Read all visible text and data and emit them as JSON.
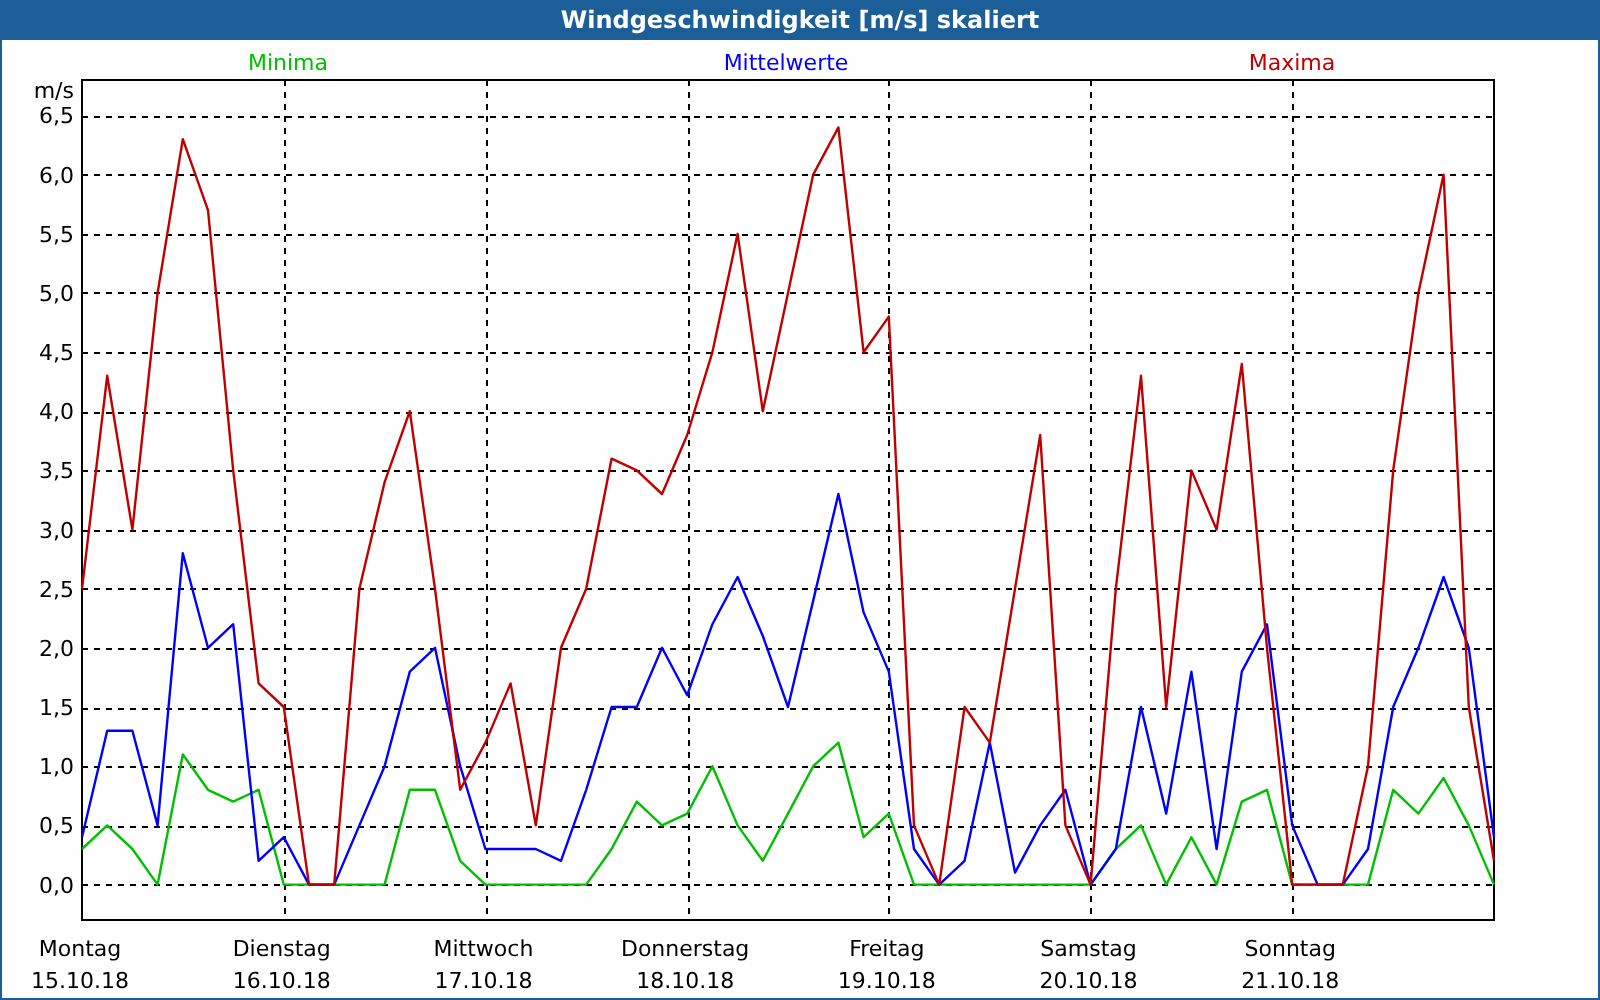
{
  "window": {
    "title": "Windgeschwindigkeit [m/s] skaliert"
  },
  "chart": {
    "dates": [
      "15.10.18",
      "16.10.18",
      "17.10.18",
      "18.10.18",
      "19.10.18",
      "20.10.18",
      "21.10.18"
    ],
    "chart_data": {
      "type": "line",
      "ylabel": "m/s",
      "ylim": [
        -0.3,
        6.8
      ],
      "grid": true,
      "yticks": [
        {
          "value": 0,
          "label": "0,0"
        },
        {
          "value": 0.5,
          "label": "0,5"
        },
        {
          "value": 1,
          "label": "1,0"
        },
        {
          "value": 1.5,
          "label": "1,5"
        },
        {
          "value": 2,
          "label": "2,0"
        },
        {
          "value": 2.5,
          "label": "2,5"
        },
        {
          "value": 3,
          "label": "3,0"
        },
        {
          "value": 3.5,
          "label": "3,5"
        },
        {
          "value": 4,
          "label": "4,0"
        },
        {
          "value": 4.5,
          "label": "4,5"
        },
        {
          "value": 5,
          "label": "5,0"
        },
        {
          "value": 5.5,
          "label": "5,5"
        },
        {
          "value": 6,
          "label": "6,0"
        },
        {
          "value": 6.5,
          "label": "6,5"
        }
      ],
      "categories": [
        "Montag",
        null,
        null,
        null,
        null,
        null,
        null,
        null,
        "Dienstag",
        null,
        null,
        null,
        null,
        null,
        null,
        null,
        "Mittwoch",
        null,
        null,
        null,
        null,
        null,
        null,
        null,
        "Donnerstag",
        null,
        null,
        null,
        null,
        null,
        null,
        null,
        "Freitag",
        null,
        null,
        null,
        null,
        null,
        null,
        null,
        "Samstag",
        null,
        null,
        null,
        null,
        null,
        null,
        null,
        "Sonntag",
        null,
        null,
        null,
        null,
        null,
        null,
        null,
        null
      ],
      "series": [
        {
          "name": "Minima",
          "color": "#00c000",
          "values": [
            0.3,
            0.5,
            0.3,
            0,
            1.1,
            0.8,
            0.7,
            0.8,
            0,
            0,
            0,
            0,
            0,
            0.8,
            0.8,
            0.2,
            0,
            0,
            0,
            0,
            0,
            0.3,
            0.7,
            0.5,
            0.6,
            1.0,
            0.5,
            0.2,
            0.6,
            1.0,
            1.2,
            0.4,
            0.6,
            0,
            0,
            0,
            0,
            0,
            0,
            0,
            0,
            0.3,
            0.5,
            0,
            0.4,
            0,
            0.7,
            0.8,
            0,
            0,
            0,
            0,
            0.8,
            0.6,
            0.9,
            0.5,
            0
          ]
        },
        {
          "name": "Mittelwerte",
          "color": "#0000ff",
          "values": [
            0.4,
            1.3,
            1.3,
            0.5,
            2.8,
            2.0,
            2.2,
            0.2,
            0.4,
            0,
            0,
            0.5,
            1.0,
            1.8,
            2.0,
            1.0,
            0.3,
            0.3,
            0.3,
            0.2,
            0.8,
            1.5,
            1.5,
            2.0,
            1.6,
            2.2,
            2.6,
            2.1,
            1.5,
            2.4,
            3.3,
            2.3,
            1.8,
            0.3,
            0,
            0.2,
            1.2,
            0.1,
            0.5,
            0.8,
            0,
            0.3,
            1.5,
            0.6,
            1.8,
            0.3,
            1.8,
            2.2,
            0.5,
            0,
            0,
            0.3,
            1.5,
            2.0,
            2.6,
            2.0,
            0.4
          ]
        },
        {
          "name": "Maxima",
          "color": "#c00000",
          "values": [
            2.5,
            4.3,
            3.0,
            5.0,
            6.3,
            5.7,
            3.5,
            1.7,
            1.5,
            0,
            0,
            2.5,
            3.4,
            4.0,
            2.5,
            0.8,
            1.2,
            1.7,
            0.5,
            2.0,
            2.5,
            3.6,
            3.5,
            3.3,
            3.8,
            4.5,
            5.5,
            4.0,
            5.0,
            6.0,
            6.4,
            4.5,
            4.8,
            0.5,
            0,
            1.5,
            1.2,
            2.5,
            3.8,
            0.5,
            0,
            2.5,
            4.3,
            1.5,
            3.5,
            3.0,
            4.4,
            2.0,
            0,
            0,
            0,
            1.0,
            3.5,
            5.0,
            6.0,
            1.5,
            0.2
          ]
        }
      ]
    }
  }
}
